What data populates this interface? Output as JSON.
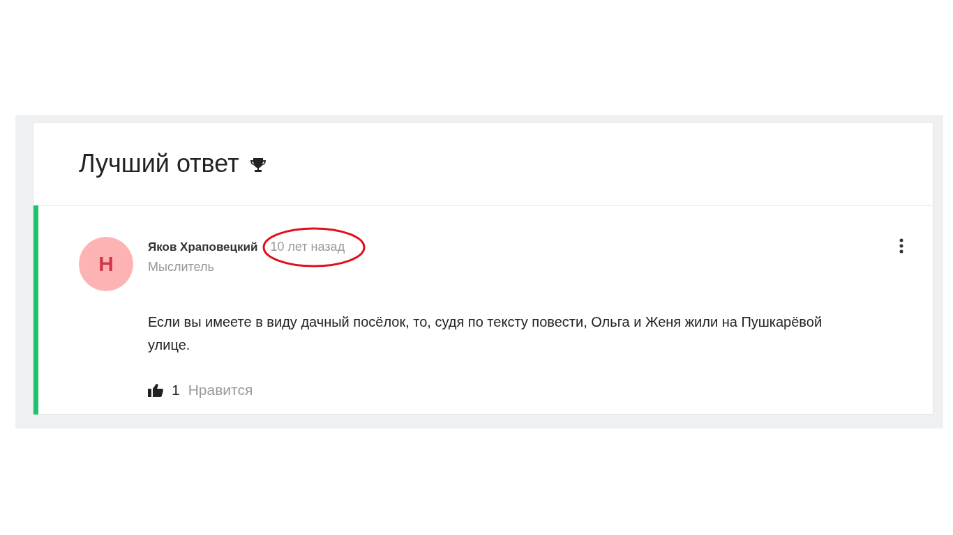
{
  "header": {
    "title": "Лучший ответ"
  },
  "answer": {
    "avatar_letter": "Н",
    "author": "Яков Храповецкий",
    "time": "10 лет назад",
    "time_circled": true,
    "rank": "Мыслитель",
    "text": "Если вы имеете в виду дачный посёлок, то, судя по тексту повести, Ольга и Женя жили на Пушкарёвой улице.",
    "likes": "1",
    "like_label": "Нравится"
  }
}
